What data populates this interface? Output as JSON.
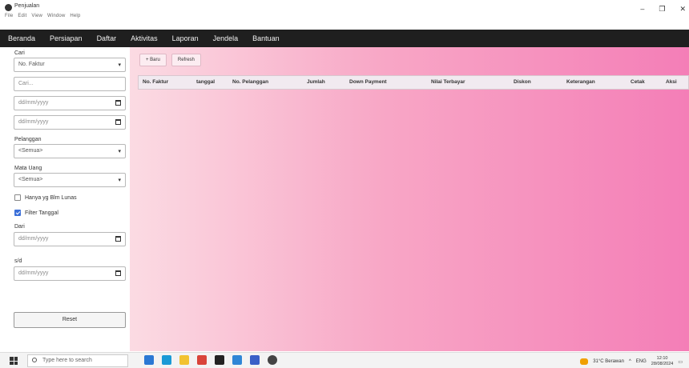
{
  "window": {
    "title": "Penjualan",
    "sys_menu": [
      "File",
      "Edit",
      "View",
      "Window",
      "Help"
    ],
    "controls": [
      "–",
      "❐",
      "✕"
    ]
  },
  "nav": {
    "items": [
      "Beranda",
      "Persiapan",
      "Daftar",
      "Aktivitas",
      "Laporan",
      "Jendela",
      "Bantuan"
    ]
  },
  "sidebar": {
    "cari_label": "Cari",
    "cari_field_value": "No. Faktur",
    "search_placeholder": "Cari...",
    "date1_placeholder": "dd/mm/yyyy",
    "date2_placeholder": "dd/mm/yyyy",
    "pelanggan_label": "Pelanggan",
    "pelanggan_value": "<Semua>",
    "mata_uang_label": "Mata Uang",
    "mata_uang_value": "<Semua>",
    "belum_lunas_label": "Hanya yg Blm Lunas",
    "belum_lunas_checked": false,
    "filter_tanggal_label": "Filter Tanggal",
    "filter_tanggal_checked": true,
    "dari_label": "Dari",
    "dari_placeholder": "dd/mm/yyyy",
    "sd_label": "s/d",
    "sd_placeholder": "dd/mm/yyyy",
    "reset_label": "Reset"
  },
  "content": {
    "new_button": "+ Baru",
    "refresh_button": "Refresh",
    "columns": [
      "No. Faktur",
      "tanggal",
      "No. Pelanggan",
      "Jumlah",
      "Down Payment",
      "Nilai Terbayar",
      "Diskon",
      "Keterangan",
      "Cetak",
      "Aksi"
    ]
  },
  "taskbar": {
    "search_placeholder": "Type here to search",
    "weather": "31°C Berawan",
    "lang": "ENG",
    "time": "12:10",
    "date": "28/08/2024"
  },
  "colors": {
    "navbar": "#1f1f1f",
    "content_gradient_start": "#fbdbe3",
    "content_gradient_end": "#f47eb7",
    "checkbox_accent": "#3b6fd8"
  }
}
